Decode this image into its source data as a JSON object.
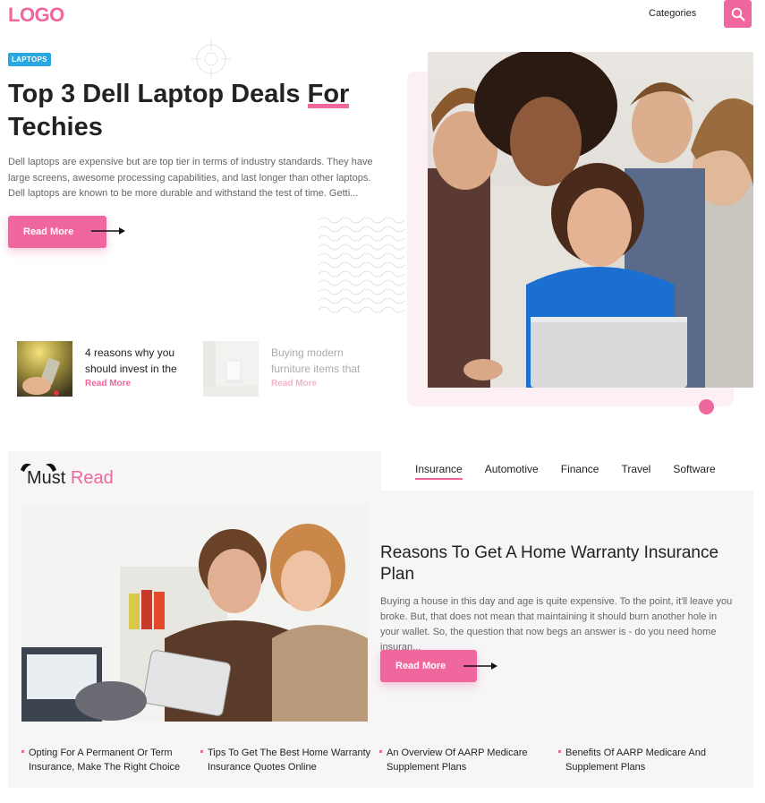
{
  "header": {
    "logo": "LOGO",
    "categories_label": "Categories",
    "search_icon": "search-icon"
  },
  "hero": {
    "badge": "LAPTOPS",
    "title_part1": "Top 3 Dell Laptop Deals ",
    "title_highlight": "For",
    "title_part2": "Techies",
    "description": "Dell laptops are expensive but are top tier in terms of industry standards. They have large screens, awesome processing capabilities, and last longer than other laptops. Dell laptops are known to be more durable and withstand the test of time. Getti...",
    "read_more": "Read More"
  },
  "mini_posts": [
    {
      "title": "4 reasons why you should invest in the",
      "link": "Read More"
    },
    {
      "title": "Buying modern furniture items that",
      "link": "Read More"
    }
  ],
  "must_read": {
    "heading_part1": "Must ",
    "heading_part2": "Read",
    "tabs": [
      "Insurance",
      "Automotive",
      "Finance",
      "Travel",
      "Software"
    ],
    "active_tab": "Insurance",
    "featured": {
      "title": "Reasons To Get A Home Warranty Insurance Plan",
      "description": "Buying a house in this day and age is quite expensive. To the point, it'll leave you broke. But, that does not mean that maintaining it should burn another hole in your wallet. So, the question that now begs an answer is - do you need home insuran...",
      "read_more": "Read More"
    },
    "links": [
      "Opting For A Permanent Or Term Insurance, Make The Right Choice",
      "Tips To Get The Best Home Warranty Insurance Quotes Online",
      "An Overview Of AARP Medicare Supplement Plans",
      "Benefits Of AARP Medicare And Supplement Plans"
    ]
  },
  "colors": {
    "accent": "#f0679e",
    "badge": "#29a7e1",
    "panel": "#f6f6f7"
  }
}
